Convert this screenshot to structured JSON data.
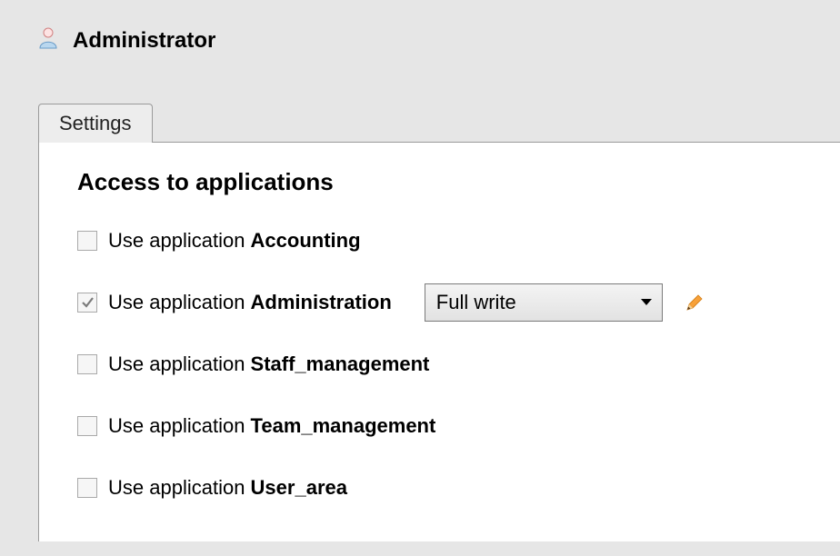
{
  "header": {
    "title": "Administrator"
  },
  "tabs": [
    {
      "label": "Settings"
    }
  ],
  "section": {
    "title": "Access to applications"
  },
  "permission_label_prefix": "Use application ",
  "applications": [
    {
      "name": "Accounting",
      "checked": false,
      "select_value": null
    },
    {
      "name": "Administration",
      "checked": true,
      "select_value": "Full write"
    },
    {
      "name": "Staff_management",
      "checked": false,
      "select_value": null
    },
    {
      "name": "Team_management",
      "checked": false,
      "select_value": null
    },
    {
      "name": "User_area",
      "checked": false,
      "select_value": null
    }
  ]
}
